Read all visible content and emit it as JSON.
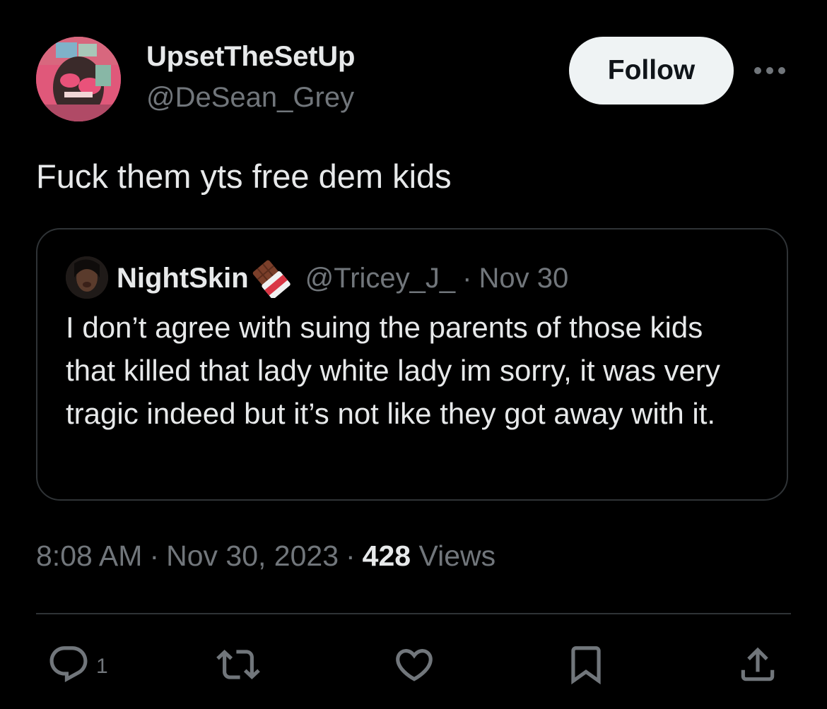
{
  "author": {
    "display_name": "UpsetTheSetUp",
    "handle": "@DeSean_Grey"
  },
  "follow_label": "Follow",
  "more_icon": "more-horizontal-icon",
  "tweet_text": "Fuck them yts free dem kids",
  "quote": {
    "display_name": "NightSkin",
    "emoji": "chocolate-bar-icon",
    "handle": "@Tricey_J_",
    "separator": "·",
    "date": "Nov 30",
    "text": "I don’t agree with suing the parents of those kids that killed that lady white lady im sorry, it was very tragic indeed but it’s not like they got away with it."
  },
  "meta": {
    "time": "8:08 AM",
    "separator": "·",
    "date": "Nov 30, 2023",
    "views_count": "428",
    "views_label": "Views"
  },
  "actions": {
    "reply_count": "1",
    "icons": [
      "reply-icon",
      "retweet-icon",
      "like-icon",
      "bookmark-icon",
      "share-icon"
    ]
  },
  "colors": {
    "background": "#000000",
    "primary_text": "#e7e9ea",
    "secondary_text": "#71767b",
    "border": "#2f3336",
    "follow_bg": "#eff3f4"
  }
}
